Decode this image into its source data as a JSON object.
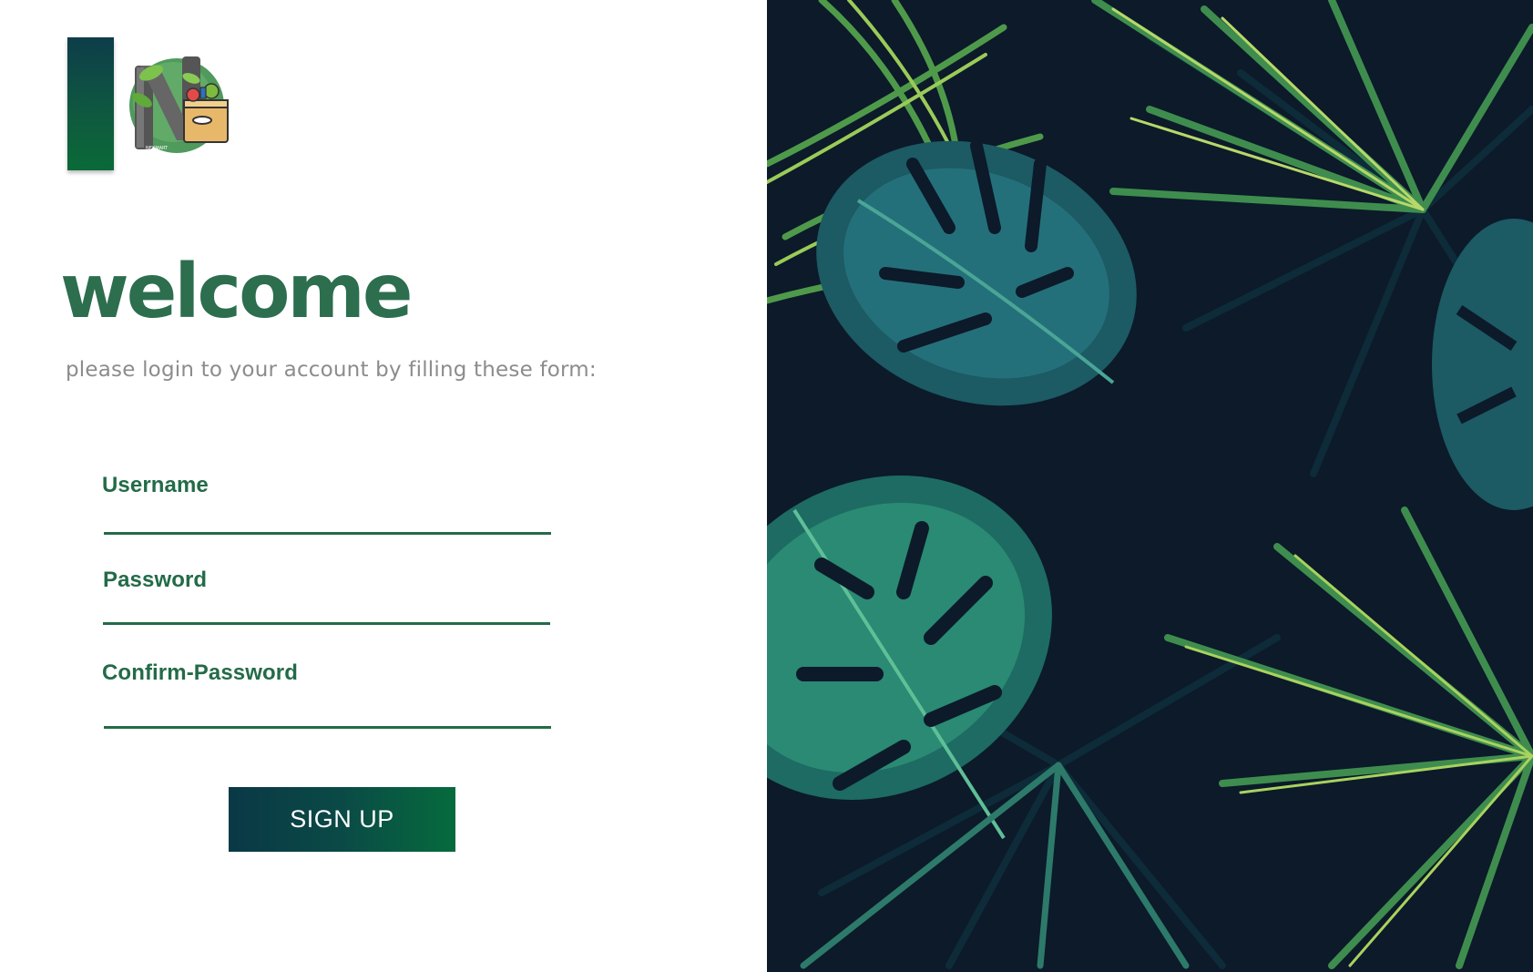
{
  "brand": {
    "logo_alt": "N",
    "logo_caption": "NEXMART"
  },
  "header": {
    "title": "welcome",
    "subtitle": "please login to your account by filling these form:"
  },
  "form": {
    "fields": [
      {
        "label": "Username",
        "value": ""
      },
      {
        "label": "Password",
        "value": ""
      },
      {
        "label": "Confirm-Password",
        "value": ""
      }
    ],
    "submit_label": "SIGN UP"
  },
  "colors": {
    "accent": "#236b48",
    "title": "#2c6e4e",
    "subtitle": "#8c8c8c",
    "button_start": "#0a3846",
    "button_end": "#066b3d",
    "background_dark": "#0c1a2a"
  },
  "decor": {
    "right_panel": "tropical-leaves-illustration"
  }
}
